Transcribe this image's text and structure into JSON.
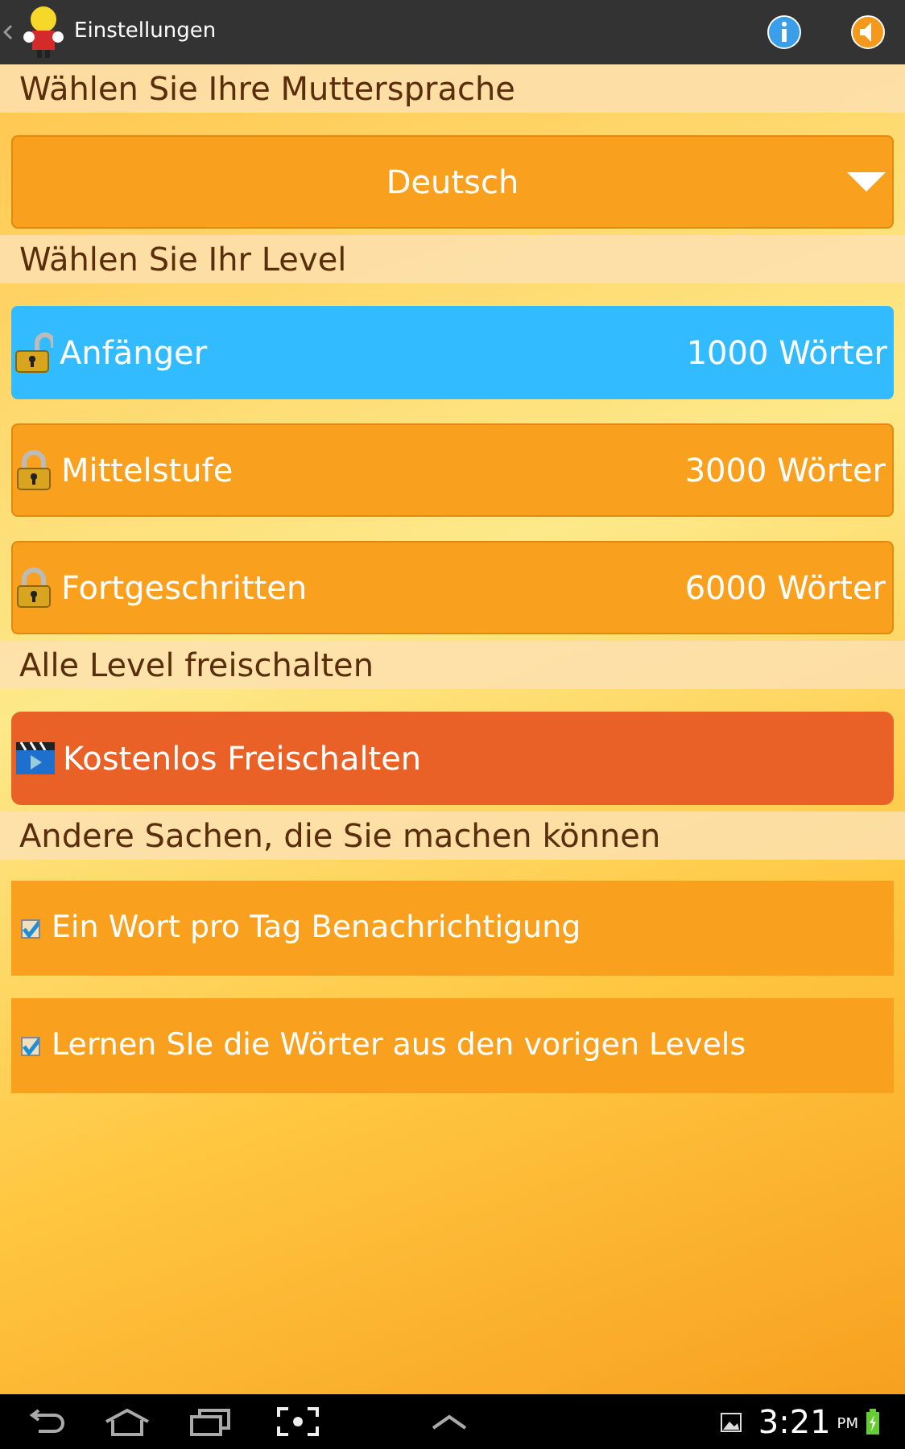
{
  "action_bar": {
    "title": "Einstellungen"
  },
  "sections": [
    {
      "kind": "dropdown",
      "header": "Wählen Sie Ihre Muttersprache",
      "value": "Deutsch"
    },
    {
      "kind": "levels",
      "header": "Wählen Sie Ihr Level",
      "items": [
        {
          "label": "Anfänger",
          "words": "1000 Wörter",
          "selected": true,
          "locked": false
        },
        {
          "label": "Mittelstufe",
          "words": "3000 Wörter",
          "selected": false,
          "locked": true
        },
        {
          "label": "Fortgeschritten",
          "words": "6000 Wörter",
          "selected": false,
          "locked": true
        }
      ]
    },
    {
      "kind": "unlock",
      "header": "Alle Level freischalten",
      "button": "Kostenlos Freischalten"
    },
    {
      "kind": "checks",
      "header": "Andere Sachen, die Sie machen können",
      "items": [
        {
          "label": "Ein Wort pro Tag Benachrichtigung",
          "checked": true
        },
        {
          "label": "Lernen SIe die Wörter aus den vorigen Levels",
          "checked": true
        }
      ]
    }
  ],
  "status_bar": {
    "time": "3:21",
    "ampm": "PM"
  }
}
